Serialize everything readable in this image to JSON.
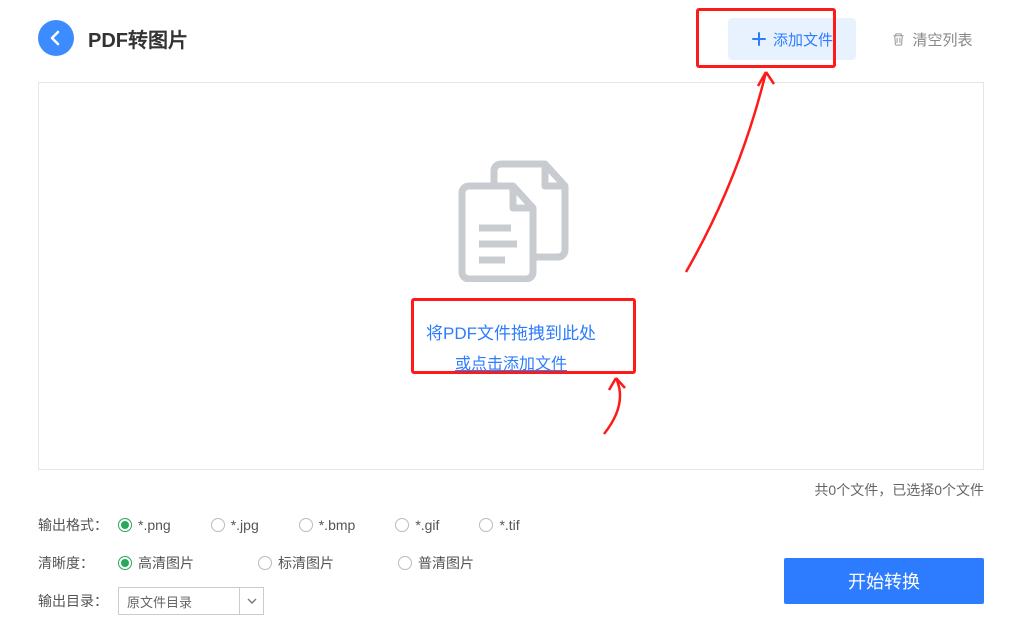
{
  "title": "PDF转图片",
  "header": {
    "addFile": "添加文件",
    "clearList": "清空列表"
  },
  "dropZone": {
    "dragText": "将PDF文件拖拽到此处",
    "clickText": "或点击添加文件"
  },
  "status": "共0个文件，已选择0个文件",
  "form": {
    "formatLabel": "输出格式：",
    "formats": [
      "*.png",
      "*.jpg",
      "*.bmp",
      "*.gif",
      "*.tif"
    ],
    "formatSelected": 0,
    "qualityLabel": "清晰度：",
    "qualities": [
      "高清图片",
      "标清图片",
      "普清图片"
    ],
    "qualitySelected": 0,
    "outputLabel": "输出目录：",
    "outputValue": "原文件目录"
  },
  "convertBtn": "开始转换"
}
